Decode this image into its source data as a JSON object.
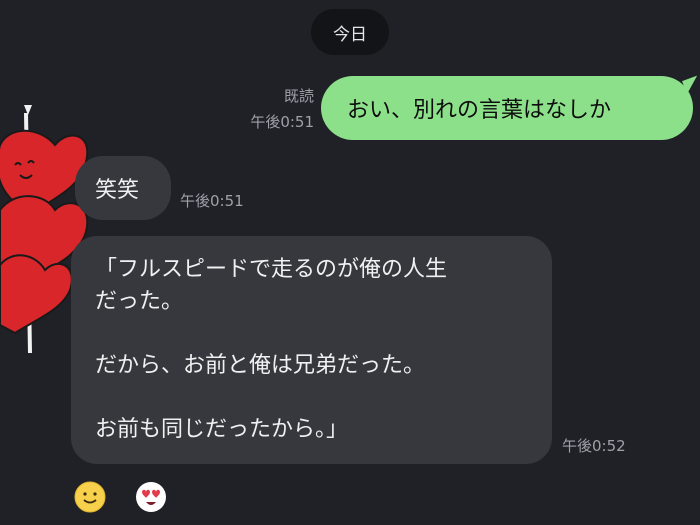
{
  "date_divider": "今日",
  "messages": {
    "outgoing": {
      "read_label": "既読",
      "time": "午後0:51",
      "text": "おい、別れの言葉はなしか"
    },
    "incoming_short": {
      "text": "笑笑",
      "time": "午後0:51"
    },
    "incoming_long": {
      "lines": [
        "「フルスピードで走るのが俺の人生",
        "だった。",
        "",
        "だから、お前と俺は兄弟だった。",
        "",
        "お前も同じだったから。」"
      ],
      "time": "午後0:52"
    }
  },
  "reactions": [
    "smile-emoji-icon",
    "heart-eyes-emoji-icon"
  ],
  "colors": {
    "background": "#1f2127",
    "outgoing_bubble": "#8de08a",
    "incoming_bubble": "#36383d",
    "date_pill": "#131417",
    "meta_text": "#9ea1a8"
  }
}
